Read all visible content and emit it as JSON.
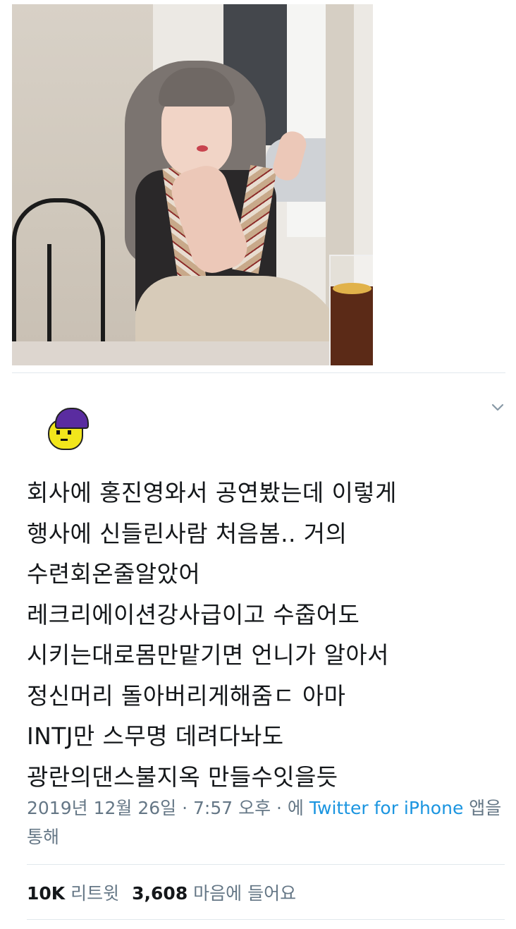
{
  "photo": {
    "icon": "photo-image"
  },
  "header": {
    "avatar_icon": "pixel-character-avatar-icon",
    "menu_icon": "chevron-down-icon"
  },
  "tweet": {
    "lines": [
      "회사에 홍진영와서 공연봤는데 이렇게",
      "행사에 신들린사람 처음봄.. 거의",
      "수련회온줄알았어",
      "레크리에이션강사급이고 수줍어도",
      "시키는대로몸만맡기면 언니가 알아서",
      "정신머리 돌아버리게해줌ㄷ  아마",
      "INTJ만 스무명 데려다놔도",
      "광란의댄스불지옥 만들수잇을듯"
    ],
    "date": "2019년 12월 26일",
    "separator": " · ",
    "time": "7:57 오후",
    "via_prefix": "에 ",
    "source_link": "Twitter for iPhone",
    "via_suffix": " 앱을 통해"
  },
  "stats": {
    "retweets_count": "10K",
    "retweets_label": "리트윗",
    "likes_count": "3,608",
    "likes_label": "마음에 들어요"
  },
  "colors": {
    "text": "#14171a",
    "secondary": "#657786",
    "link": "#1b95e0",
    "divider": "#e1e8ed"
  }
}
